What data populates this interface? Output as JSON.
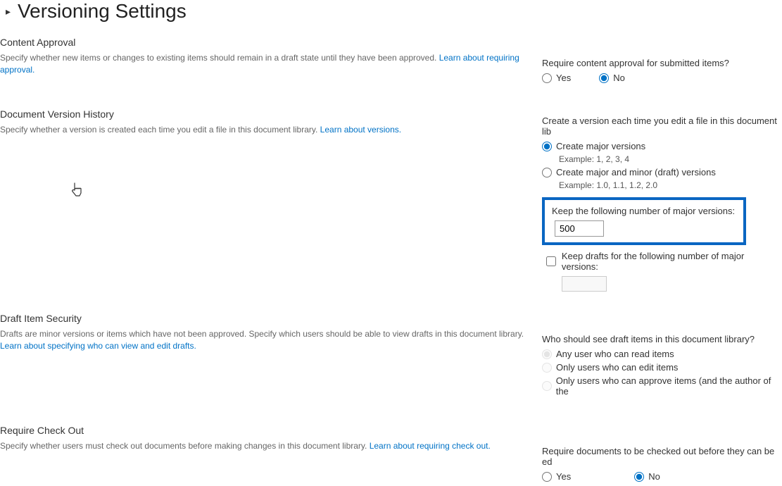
{
  "page": {
    "title": "Versioning Settings"
  },
  "sections": {
    "content_approval": {
      "heading": "Content Approval",
      "desc": "Specify whether new items or changes to existing items should remain in a draft state until they have been approved.  ",
      "link": "Learn about requiring approval.",
      "right_label": "Require content approval for submitted items?",
      "yes": "Yes",
      "no": "No"
    },
    "version_history": {
      "heading": "Document Version History",
      "desc": "Specify whether a version is created each time you edit a file in this document library.  ",
      "link": "Learn about versions.",
      "right_label": "Create a version each time you edit a file in this document lib",
      "opt_major": "Create major versions",
      "example_major": "Example: 1, 2, 3, 4",
      "opt_minor": "Create major and minor (draft) versions",
      "example_minor": "Example: 1.0, 1.1, 1.2, 2.0",
      "keep_major_label": "Keep the following number of major versions:",
      "keep_major_value": "500",
      "keep_drafts_label": "Keep drafts for the following number of major versions:"
    },
    "draft_security": {
      "heading": "Draft Item Security",
      "desc": "Drafts are minor versions or items which have not been approved. Specify which users should be able to view drafts in this document library.  ",
      "link": "Learn about specifying who can view and edit drafts.",
      "right_label": "Who should see draft items in this document library?",
      "opt_any": "Any user who can read items",
      "opt_edit": "Only users who can edit items",
      "opt_approve": "Only users who can approve items (and the author of the"
    },
    "checkout": {
      "heading": "Require Check Out",
      "desc": "Specify whether users must check out documents before making changes in this document library.  ",
      "link": "Learn about requiring check out.",
      "right_label": "Require documents to be checked out before they can be ed",
      "yes": "Yes",
      "no": "No"
    }
  }
}
